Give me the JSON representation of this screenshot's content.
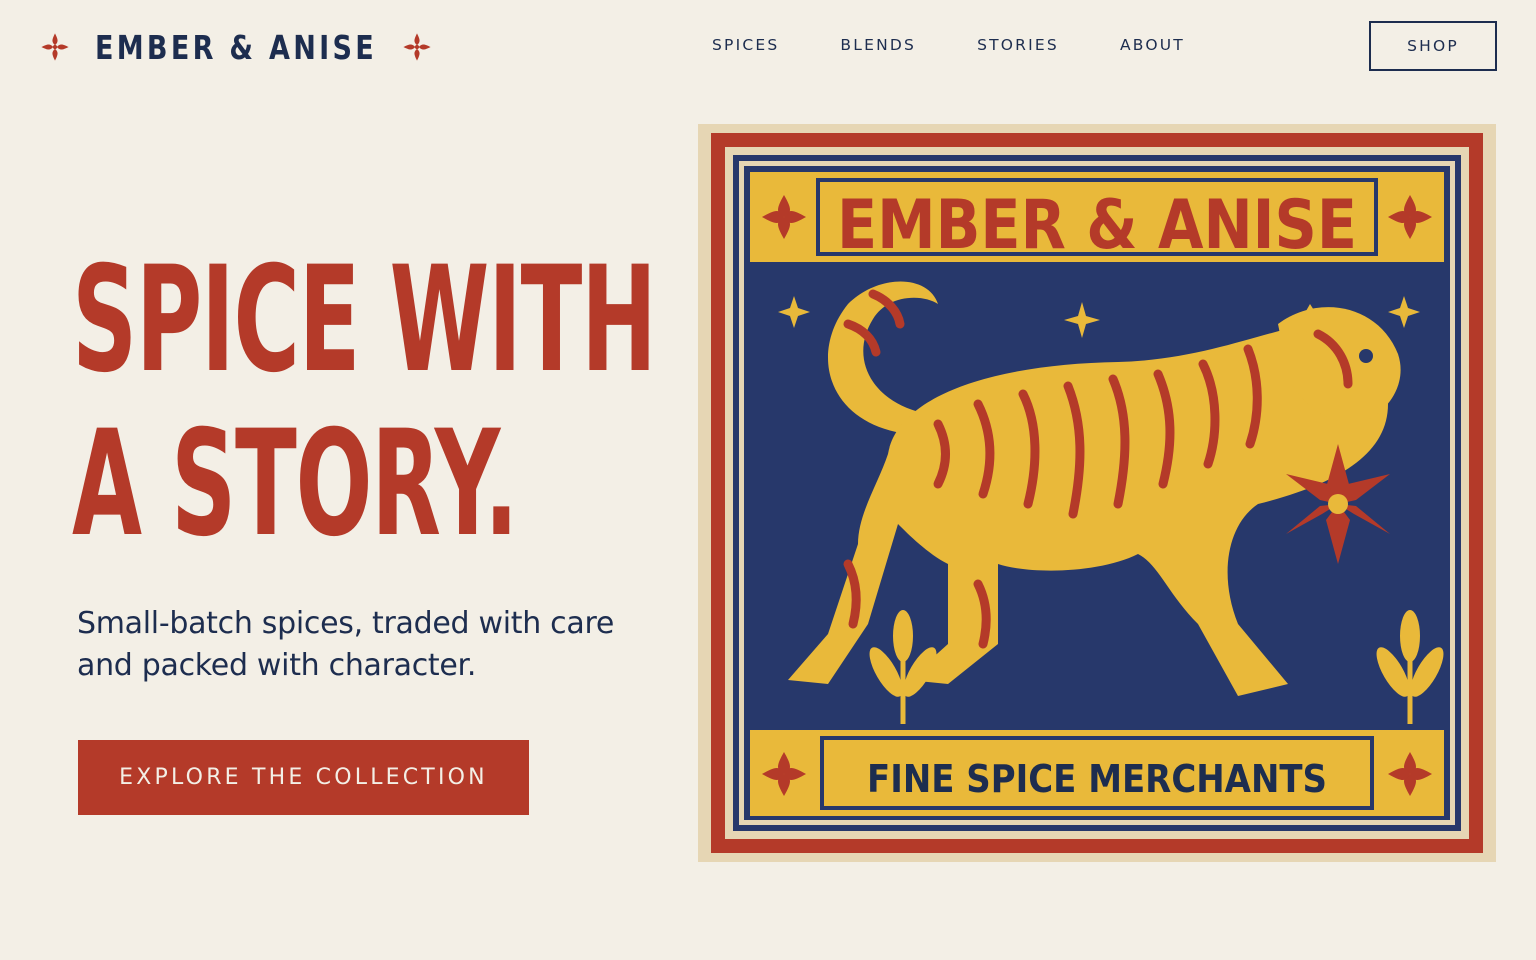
{
  "brand": {
    "name": "EMBER & ANISE",
    "icon": "floral-flourish-icon"
  },
  "nav": {
    "items": [
      {
        "label": "SPICES"
      },
      {
        "label": "BLENDS"
      },
      {
        "label": "STORIES"
      },
      {
        "label": "ABOUT"
      }
    ],
    "shop_label": "SHOP"
  },
  "hero": {
    "headline_line1": "SPICE WITH",
    "headline_line2": "A STORY.",
    "subhead": "Small-batch spices, traded with care and packed with character.",
    "cta_label": "EXPLORE THE COLLECTION"
  },
  "label_art": {
    "top_text": "EMBER & ANISE",
    "bottom_text": "FINE SPICE MERCHANTS",
    "subject": "tiger carrying star anise"
  },
  "colors": {
    "background": "#f3efe6",
    "navy": "#1d2d4f",
    "brick_red": "#b43a29",
    "mustard": "#e9b93a",
    "label_blue": "#27386b"
  }
}
